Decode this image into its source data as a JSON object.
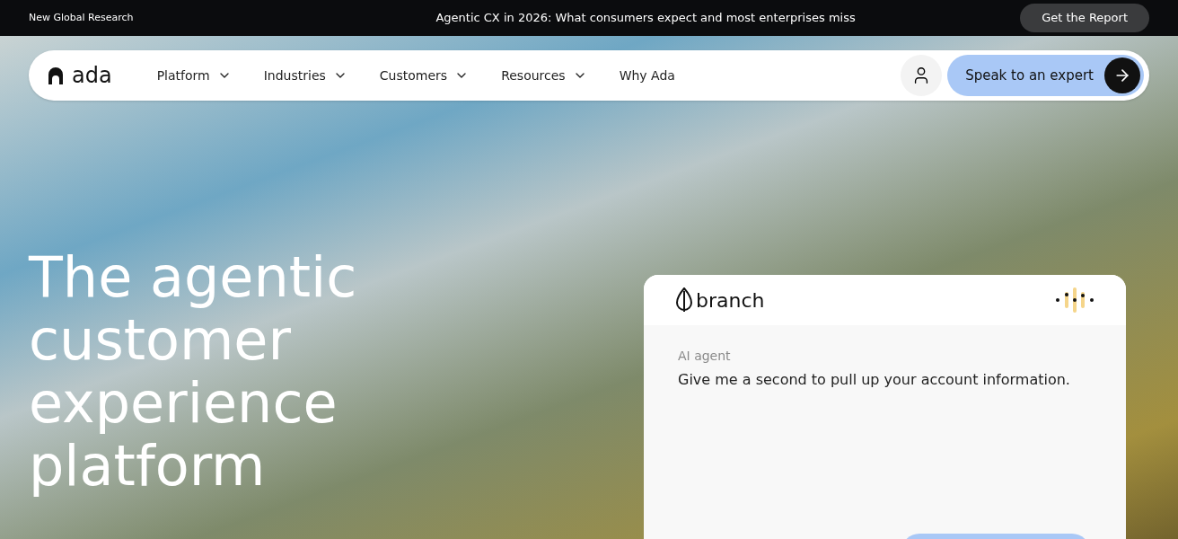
{
  "announcement_bar": {
    "label": "New Global Research",
    "headline": "Agentic CX in 2026: What consumers expect and most enterprises miss",
    "button": "Get the Report"
  },
  "navbar": {
    "logo": "ada",
    "items": [
      {
        "label": "Platform",
        "dropdown": true
      },
      {
        "label": "Industries",
        "dropdown": true
      },
      {
        "label": "Customers",
        "dropdown": true
      },
      {
        "label": "Resources",
        "dropdown": true
      },
      {
        "label": "Why Ada",
        "dropdown": false
      }
    ],
    "cta": "Speak to an expert"
  },
  "hero": {
    "heading_lines": [
      "The agentic",
      "customer",
      "experience",
      "platform"
    ]
  },
  "chat_card": {
    "brand": "branch",
    "sender": "AI agent",
    "message": "Give me a second to pull up your account information."
  }
}
